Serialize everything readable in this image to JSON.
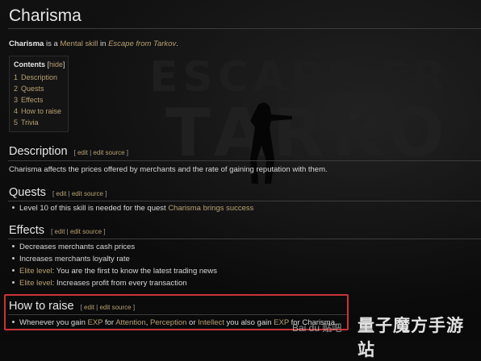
{
  "title": "Charisma",
  "intro": {
    "bold": "Charisma",
    "text1": " is a ",
    "link1": "Mental skill",
    "text2": " in ",
    "link2": "Escape from Tarkov",
    "text3": "."
  },
  "toc": {
    "title": "Contents",
    "hide_open": " [",
    "hide": "hide",
    "hide_close": "]",
    "items": [
      {
        "num": "1",
        "label": "Description"
      },
      {
        "num": "2",
        "label": "Quests"
      },
      {
        "num": "3",
        "label": "Effects"
      },
      {
        "num": "4",
        "label": "How to raise"
      },
      {
        "num": "5",
        "label": "Trivia"
      }
    ]
  },
  "edit_links": {
    "open": "[ ",
    "edit": "edit",
    "sep": " | ",
    "edit_source": "edit source",
    "close": " ]"
  },
  "sections": {
    "description": {
      "heading": "Description",
      "text": "Charisma affects the prices offered by merchants and the rate of gaining reputation with them."
    },
    "quests": {
      "heading": "Quests",
      "item_text": "Level 10 of this skill is needed for the quest ",
      "item_link": "Charisma brings success"
    },
    "effects": {
      "heading": "Effects",
      "items": [
        {
          "link": "",
          "text": "Decreases merchants cash prices"
        },
        {
          "link": "",
          "text": "Increases merchants loyalty rate"
        },
        {
          "link": "Elite level",
          "text": ": You are the first to know the latest trading news"
        },
        {
          "link": "Elite level",
          "text": ": Increases profit from every transaction"
        }
      ]
    },
    "how_to_raise": {
      "heading": "How to raise",
      "parts": [
        {
          "t": "Whenever you gain ",
          "link": false
        },
        {
          "t": "EXP",
          "link": true
        },
        {
          "t": " for ",
          "link": false
        },
        {
          "t": "Attention",
          "link": true
        },
        {
          "t": ", ",
          "link": false
        },
        {
          "t": "Perception",
          "link": true
        },
        {
          "t": " or ",
          "link": false
        },
        {
          "t": "Intellect",
          "link": true
        },
        {
          "t": " you also gain ",
          "link": false
        },
        {
          "t": "EXP",
          "link": true
        },
        {
          "t": " for Charisma.",
          "link": false
        }
      ]
    }
  },
  "background_text": {
    "line1": "ESCAPE FR",
    "line2": "TARKO"
  },
  "watermark": {
    "small": "Bai du 贴吧",
    "large": "量子魔方手游站"
  },
  "colors": {
    "link": "#b8a071",
    "highlight_box": "#c9343a",
    "background": "#0b0b0b"
  }
}
